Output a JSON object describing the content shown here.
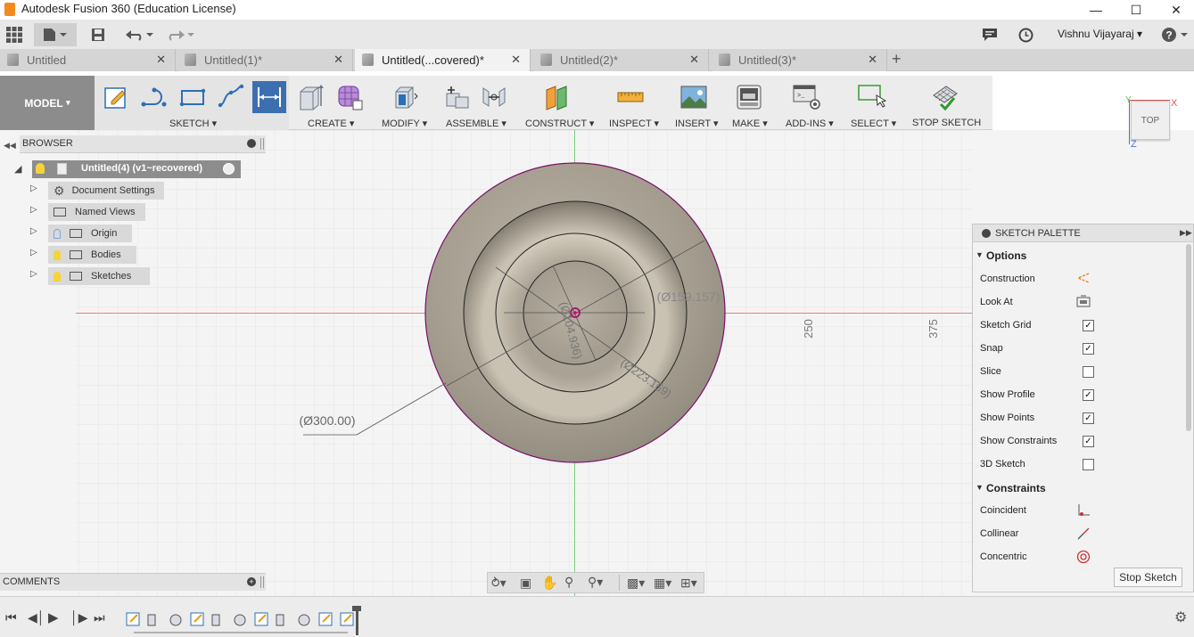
{
  "window": {
    "title": "Autodesk Fusion 360 (Education License)"
  },
  "appbar": {
    "user_name": "Vishnu Vijayaraj"
  },
  "tabs": [
    {
      "label": "Untitled",
      "active": false
    },
    {
      "label": "Untitled(1)*",
      "active": false
    },
    {
      "label": "Untitled(...covered)*",
      "active": true
    },
    {
      "label": "Untitled(2)*",
      "active": false
    },
    {
      "label": "Untitled(3)*",
      "active": false
    }
  ],
  "toolbar": {
    "workspace": "MODEL",
    "groups": [
      "SKETCH",
      "CREATE",
      "MODIFY",
      "ASSEMBLE",
      "CONSTRUCT",
      "INSPECT",
      "INSERT",
      "MAKE",
      "ADD-INS",
      "SELECT",
      "STOP SKETCH"
    ]
  },
  "browser": {
    "title": "BROWSER",
    "root": "Untitled(4) (v1~recovered)",
    "items": [
      {
        "label": "Document Settings",
        "icon": "gear-icon"
      },
      {
        "label": "Named Views",
        "icon": "folder-icon"
      },
      {
        "label": "Origin",
        "icon": "folder-icon"
      },
      {
        "label": "Bodies",
        "icon": "folder-icon"
      },
      {
        "label": "Sketches",
        "icon": "folder-icon"
      }
    ]
  },
  "comments": {
    "label": "COMMENTS"
  },
  "viewcube": {
    "face": "TOP",
    "axis_x": "X",
    "axis_y": "Y",
    "axis_z": "Z"
  },
  "canvas": {
    "dimensions": {
      "outer": "(Ø300.00)",
      "d159": "(Ø159.157)",
      "d104": "(Ø104.936)",
      "d223": "(Ø223.169)"
    },
    "ruler": {
      "tick_250": "250",
      "tick_375": "375"
    }
  },
  "palette": {
    "title": "SKETCH PALETTE",
    "options_header": "Options",
    "options": [
      {
        "label": "Construction",
        "type": "icon",
        "icon": "construction-icon"
      },
      {
        "label": "Look At",
        "type": "icon",
        "icon": "look-at-icon"
      },
      {
        "label": "Sketch Grid",
        "type": "check",
        "checked": true
      },
      {
        "label": "Snap",
        "type": "check",
        "checked": true
      },
      {
        "label": "Slice",
        "type": "check",
        "checked": false
      },
      {
        "label": "Show Profile",
        "type": "check",
        "checked": true
      },
      {
        "label": "Show Points",
        "type": "check",
        "checked": true
      },
      {
        "label": "Show Constraints",
        "type": "check",
        "checked": true
      },
      {
        "label": "3D Sketch",
        "type": "check",
        "checked": false
      }
    ],
    "constraints_header": "Constraints",
    "constraints": [
      {
        "label": "Coincident",
        "icon": "coincident-icon"
      },
      {
        "label": "Collinear",
        "icon": "collinear-icon"
      },
      {
        "label": "Concentric",
        "icon": "concentric-icon"
      }
    ],
    "stop_button": "Stop Sketch"
  },
  "colors": {
    "accent_sketch": "#3d6fb0",
    "body_fill": "#a49d8f",
    "profile_line": "#7a0f6b",
    "axis_red": "#e88080",
    "axis_green": "#7ccf7c"
  }
}
